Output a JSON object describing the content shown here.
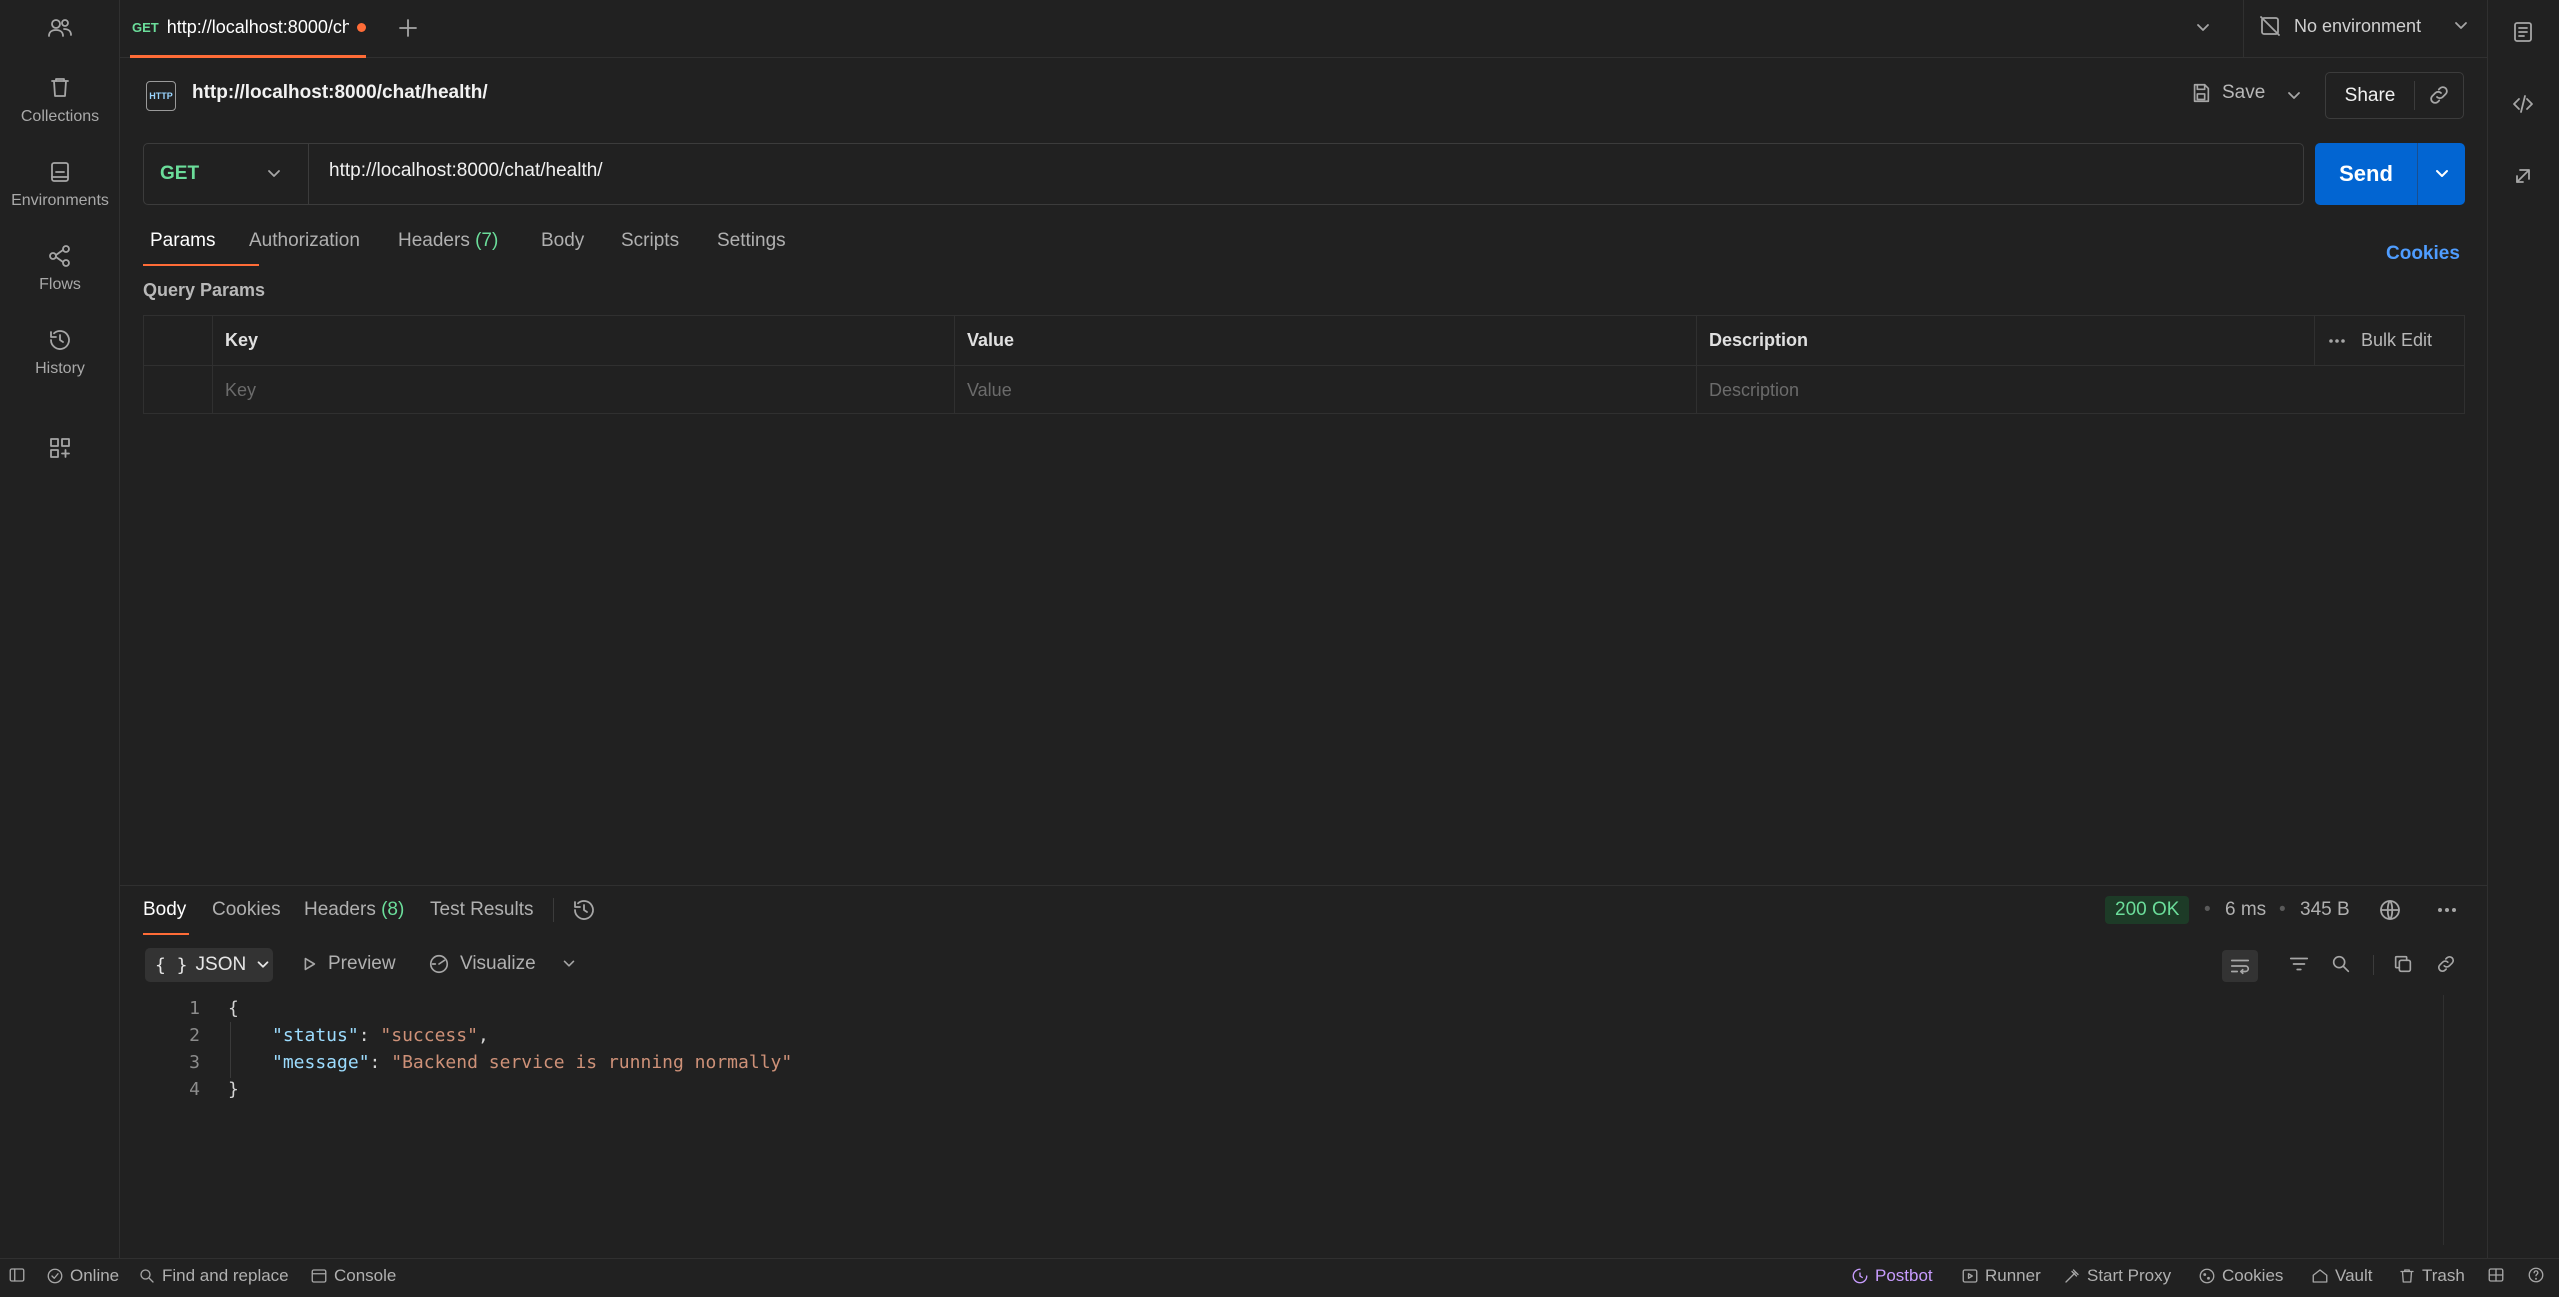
{
  "sidebar": {
    "items": [
      {
        "label": "Collections",
        "icon": "trash-can-icon"
      },
      {
        "label": "Environments",
        "icon": "environment-icon"
      },
      {
        "label": "Flows",
        "icon": "flows-icon"
      },
      {
        "label": "History",
        "icon": "history-icon"
      }
    ]
  },
  "topbar": {
    "tab_method": "GET",
    "tab_title": "http://localhost:8000/ch",
    "environment": "No environment"
  },
  "request": {
    "title": "http://localhost:8000/chat/health/",
    "http_badge": "HTTP",
    "save_label": "Save",
    "share_label": "Share",
    "method": "GET",
    "url": "http://localhost:8000/chat/health/",
    "send_label": "Send",
    "tabs": {
      "params": "Params",
      "authorization": "Authorization",
      "headers": "Headers",
      "headers_count": "(7)",
      "body": "Body",
      "scripts": "Scripts",
      "settings": "Settings"
    },
    "cookies_label": "Cookies"
  },
  "params": {
    "section_title": "Query Params",
    "headers": {
      "key": "Key",
      "value": "Value",
      "description": "Description"
    },
    "bulk_edit": "Bulk Edit",
    "placeholders": {
      "key": "Key",
      "value": "Value",
      "description": "Description"
    }
  },
  "response": {
    "tabs": {
      "body": "Body",
      "cookies": "Cookies",
      "headers": "Headers",
      "headers_count": "(8)",
      "test_results": "Test Results"
    },
    "status": "200 OK",
    "time": "6 ms",
    "size": "345 B",
    "format": "JSON",
    "preview_label": "Preview",
    "visualize_label": "Visualize",
    "lines": [
      {
        "n": "1",
        "open": "{"
      },
      {
        "n": "2",
        "key": "\"status\"",
        "value": "\"success\"",
        "trail": ","
      },
      {
        "n": "3",
        "key": "\"message\"",
        "value": "\"Backend service is running normally\"",
        "trail": ""
      },
      {
        "n": "4",
        "close": "}"
      }
    ]
  },
  "statusbar": {
    "online": "Online",
    "find_replace": "Find and replace",
    "console": "Console",
    "postbot": "Postbot",
    "runner": "Runner",
    "start_proxy": "Start Proxy",
    "cookies": "Cookies",
    "vault": "Vault",
    "trash": "Trash"
  },
  "colors": {
    "accent": "#ff6c37",
    "send": "#0265d2",
    "method_get": "#6bdd9a",
    "link_blue": "#4f9dff",
    "postbot": "#c89cff"
  }
}
